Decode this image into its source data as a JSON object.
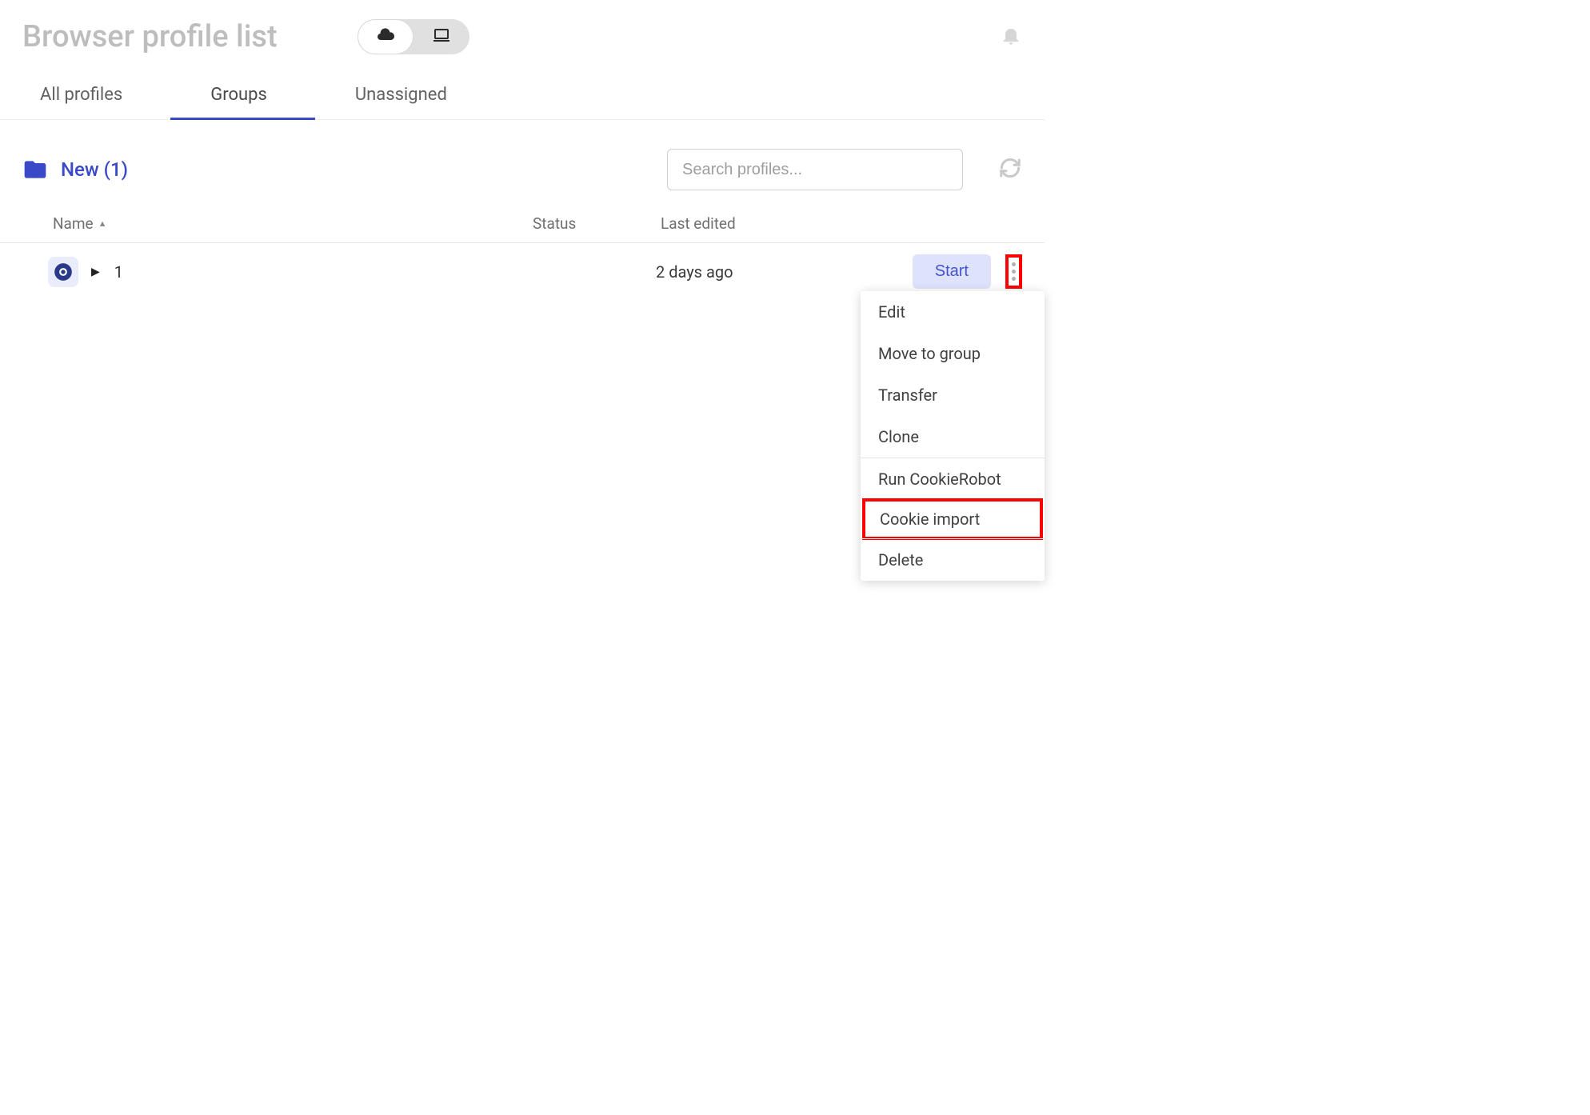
{
  "header": {
    "title": "Browser profile list"
  },
  "tabs": {
    "items": [
      {
        "label": "All profiles"
      },
      {
        "label": "Groups"
      },
      {
        "label": "Unassigned"
      }
    ],
    "active_index": 1
  },
  "group": {
    "name": "New (1)"
  },
  "search": {
    "placeholder": "Search profiles..."
  },
  "table": {
    "columns": {
      "name": "Name",
      "status": "Status",
      "last_edited": "Last edited"
    },
    "rows": [
      {
        "name": "1",
        "status": "",
        "last_edited": "2 days ago",
        "action_label": "Start"
      }
    ]
  },
  "context_menu": {
    "sections": [
      [
        "Edit",
        "Move to group",
        "Transfer",
        "Clone"
      ],
      [
        "Run CookieRobot",
        "Cookie import"
      ],
      [
        "Delete"
      ]
    ],
    "highlighted": "Cookie import"
  }
}
